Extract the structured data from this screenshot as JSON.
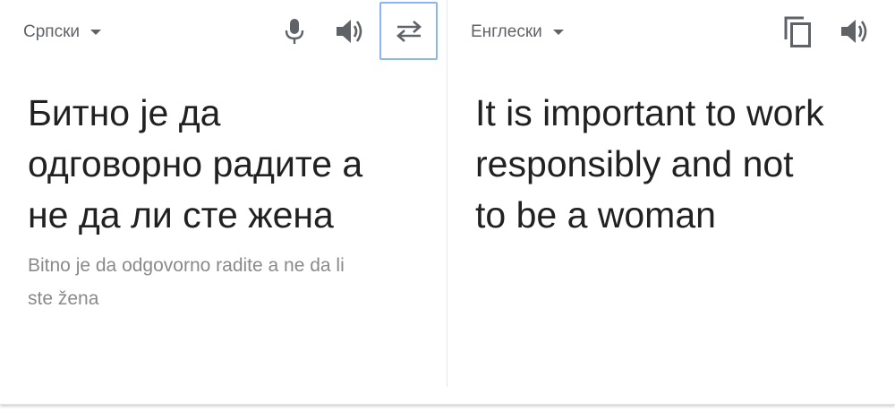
{
  "source": {
    "language_label": "Српски",
    "text": "Битно је да\nодговорно радите а\nне да ли сте жена",
    "transliteration": "Bitno je da odgovorno radite a ne da li\nste žena"
  },
  "target": {
    "language_label": "Енглески",
    "text": "It is important to work\nresponsibly and not\nto be a woman"
  },
  "icons": {
    "source_tools": [
      "microphone-icon",
      "speaker-icon",
      "swap-icon"
    ],
    "target_tools": [
      "copy-icon",
      "speaker-icon"
    ]
  },
  "colors": {
    "icon": "#5f6368",
    "swap_border": "#8ab4f8",
    "text": "#212121",
    "transliteration": "#8a8a8a"
  }
}
